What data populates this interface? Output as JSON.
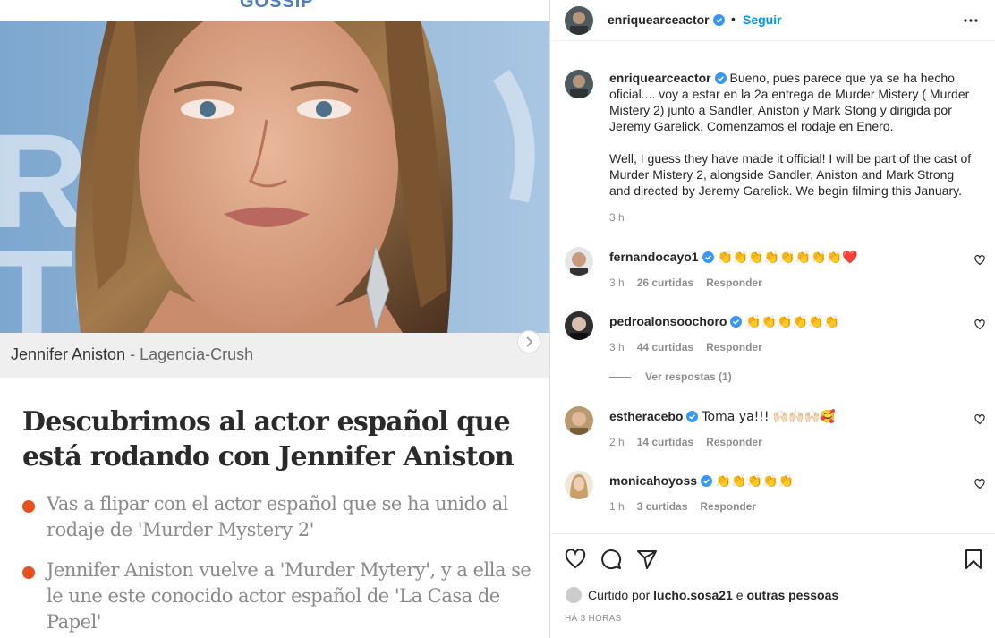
{
  "article": {
    "brand": "GOSSIP",
    "photo_caption_name": "Jennifer Aniston",
    "photo_caption_source": " - Lagencia-Crush",
    "headline": "Descubrimos al actor español que está rodando con Jennifer Aniston",
    "bullets": [
      "Vas a flipar con el actor español que se ha unido al rodaje de 'Murder Mystery 2'",
      "Jennifer Aniston vuelve a 'Murder Mytery', y a ella se le une este conocido actor español de 'La Casa de Papel'"
    ],
    "accent_color": "#e8511d"
  },
  "post": {
    "author": "enriquearceactor",
    "separator": "•",
    "follow_label": "Seguir",
    "more_icon": "more-dots-icon",
    "caption_es": "Bueno, pues parece que ya se ha hecho oficial.... voy a estar en la 2a entrega de Murder Mistery ( Murder Mistery 2) junto a Sandler, Aniston y Mark Stong y dirigida por Jeremy Garelick. Comenzamos el rodaje en Enero.",
    "caption_en": "Well, I guess they have made it official! I will be part of the cast of Murder Mistery 2, alongside Sandler, Aniston and Mark Strong and directed by Jeremy Garelick. We begin filming this January.",
    "caption_time": "3 h",
    "reply_label": "Responder",
    "view_replies": "Ver respostas (1)",
    "comments": [
      {
        "user": "fernandocayo1",
        "text": "👏👏👏👏👏👏👏👏❤️",
        "time": "3 h",
        "likes": "26 curtidas"
      },
      {
        "user": "pedroalonsoochoro",
        "text": "👏👏👏👏👏👏",
        "time": "3 h",
        "likes": "44 curtidas"
      },
      {
        "user": "estheracebo",
        "text": "Toma ya!!! 🙌🏻🙌🏻🙌🏻🥰",
        "time": "2 h",
        "likes": "14 curtidas"
      },
      {
        "user": "monicahoyoss",
        "text": "👏👏👏👏👏",
        "time": "1 h",
        "likes": "3 curtidas"
      }
    ],
    "liked_by_prefix": "Curtido por",
    "liked_by_user": "lucho.sosa21",
    "liked_by_suffix": "e",
    "liked_by_others": "outras pessoas",
    "timestamp": "HÁ 3 HORAS",
    "colors": {
      "link": "#0095f6",
      "muted": "#8e8e8e",
      "verified": "#3897f0"
    }
  }
}
